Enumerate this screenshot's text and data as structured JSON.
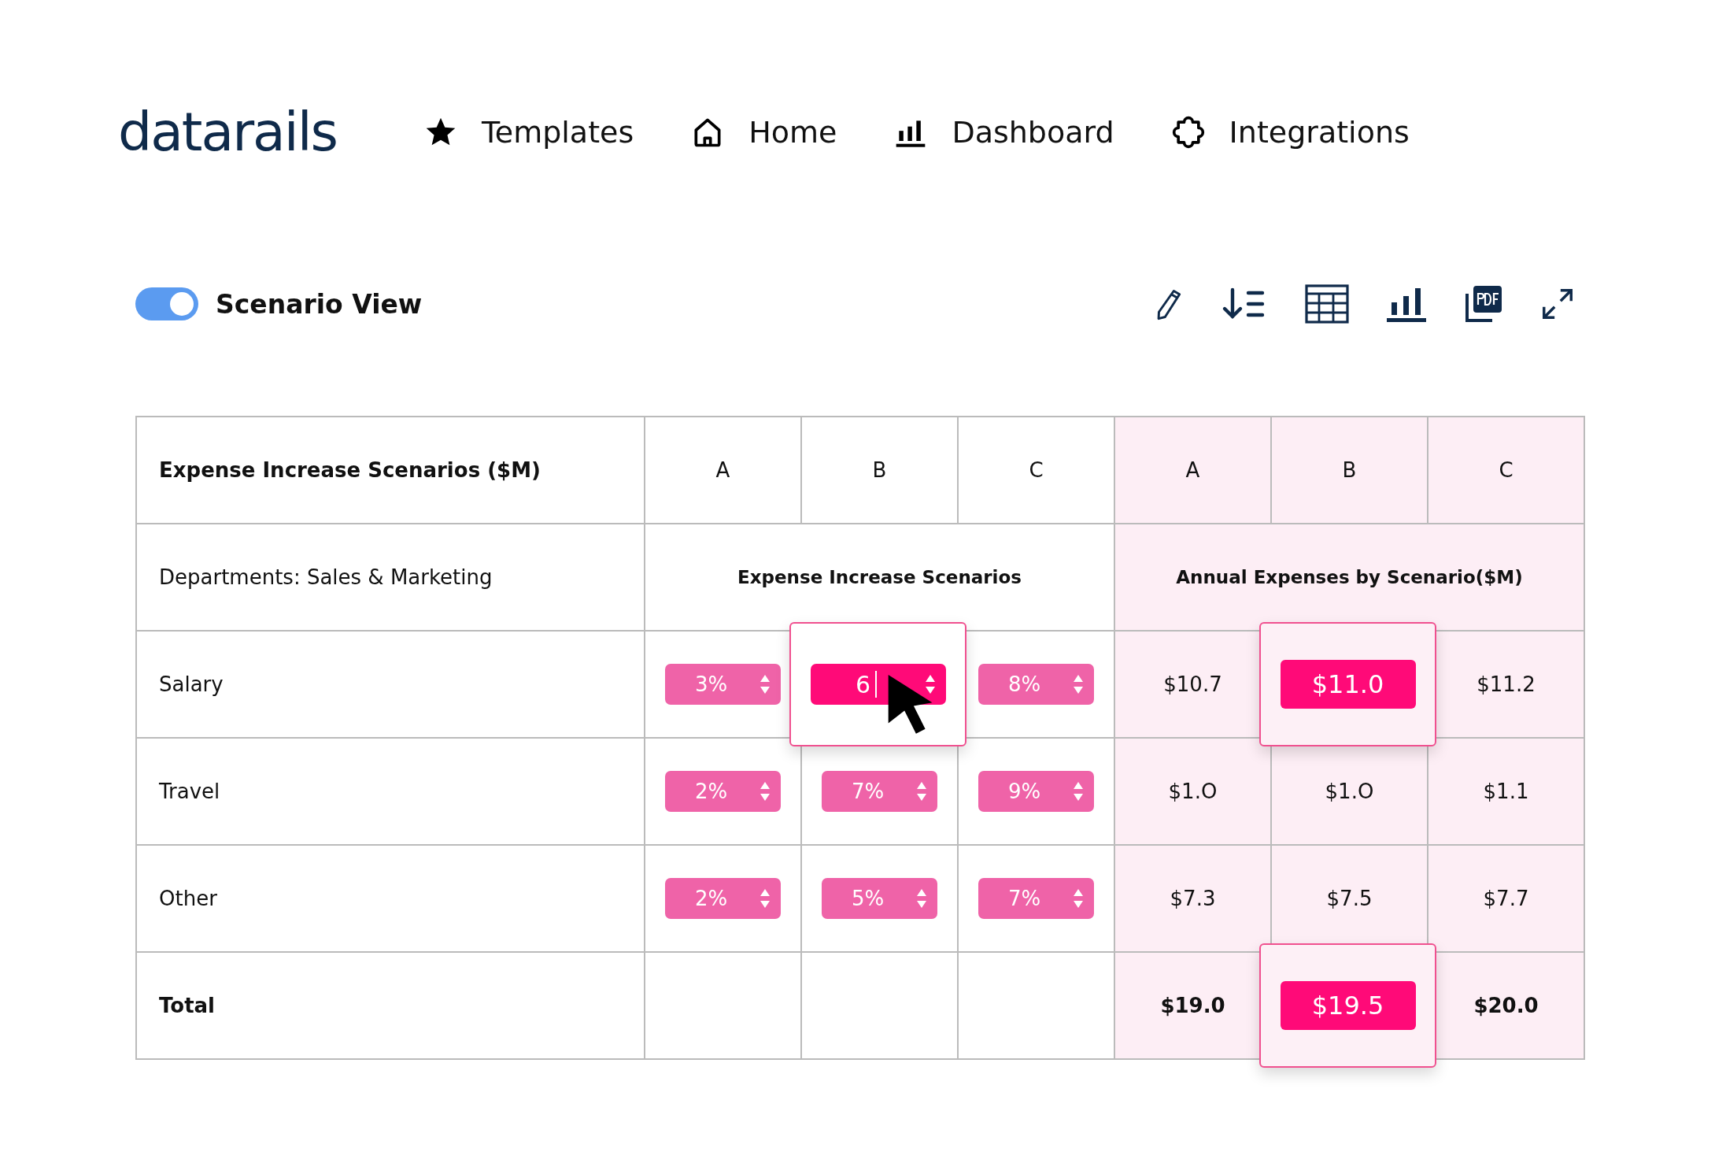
{
  "logo": "datarails",
  "nav": [
    {
      "label": "Templates"
    },
    {
      "label": "Home"
    },
    {
      "label": "Dashboard"
    },
    {
      "label": "Integrations"
    }
  ],
  "scenario_view": {
    "label": "Scenario View",
    "on": true
  },
  "table": {
    "title": "Expense Increase Scenarios ($M)",
    "left_columns": [
      "A",
      "B",
      "C"
    ],
    "right_columns": [
      "A",
      "B",
      "C"
    ],
    "group_label": "Departments: Sales & Marketing",
    "left_group": "Expense Increase Scenarios",
    "right_group": "Annual Expenses by Scenario($M)",
    "rows": [
      {
        "label": "Salary",
        "inputs": [
          {
            "value": "3%",
            "focused": false
          },
          {
            "value": "6",
            "focused": true
          },
          {
            "value": "8%",
            "focused": false
          }
        ],
        "amounts": [
          {
            "value": "$10.7",
            "highlighted": false
          },
          {
            "value": "$11.0",
            "highlighted": true
          },
          {
            "value": "$11.2",
            "highlighted": false
          }
        ]
      },
      {
        "label": "Travel",
        "inputs": [
          {
            "value": "2%",
            "focused": false
          },
          {
            "value": "7%",
            "focused": false
          },
          {
            "value": "9%",
            "focused": false
          }
        ],
        "amounts": [
          {
            "value": "$1.O",
            "highlighted": false
          },
          {
            "value": "$1.O",
            "highlighted": false
          },
          {
            "value": "$1.1",
            "highlighted": false
          }
        ]
      },
      {
        "label": "Other",
        "inputs": [
          {
            "value": "2%",
            "focused": false
          },
          {
            "value": "5%",
            "focused": false
          },
          {
            "value": "7%",
            "focused": false
          }
        ],
        "amounts": [
          {
            "value": "$7.3",
            "highlighted": false
          },
          {
            "value": "$7.5",
            "highlighted": false
          },
          {
            "value": "$7.7",
            "highlighted": false
          }
        ]
      }
    ],
    "total": {
      "label": "Total",
      "amounts": [
        {
          "value": "$19.0",
          "highlighted": false
        },
        {
          "value": "$19.5",
          "highlighted": true
        },
        {
          "value": "$20.0",
          "highlighted": false
        }
      ]
    }
  }
}
